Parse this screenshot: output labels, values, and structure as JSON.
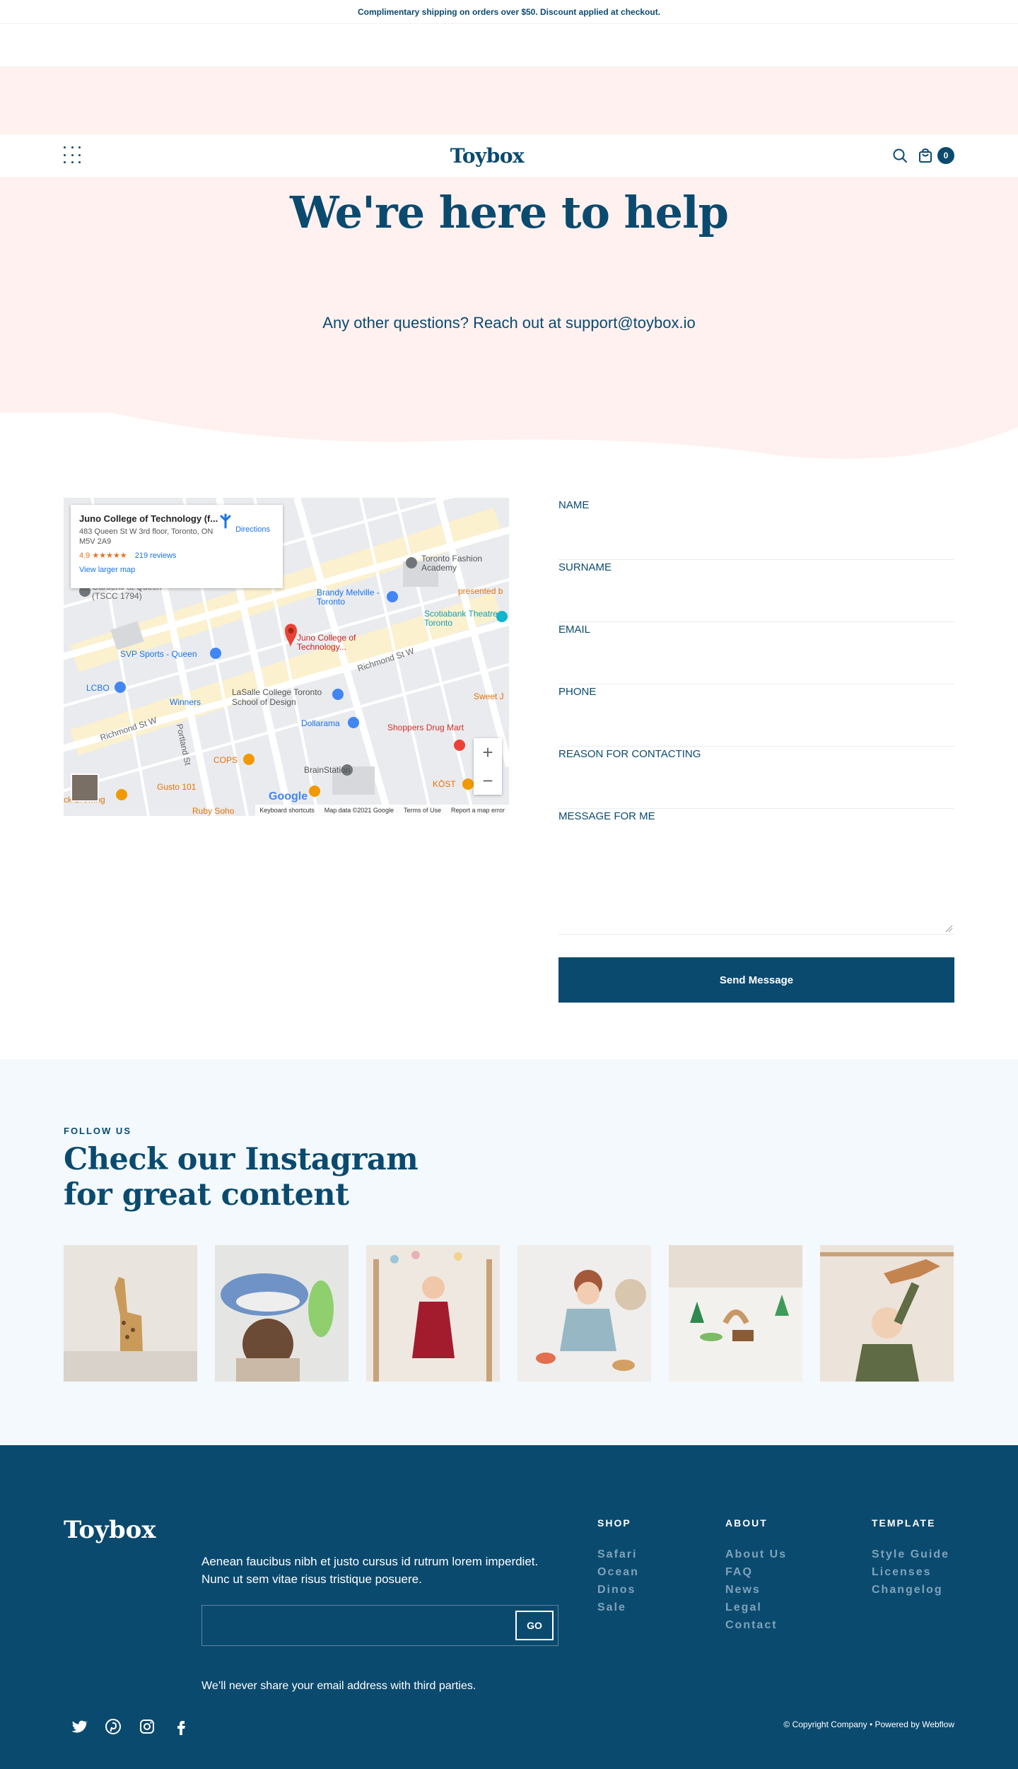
{
  "announcement": "Complimentary shipping on orders over $50. Discount applied at checkout.",
  "nav": {
    "logo": "Toybox",
    "cart_count": "0"
  },
  "hero": {
    "title": "We're here to help",
    "subtitle": "Any other questions? Reach out at support@toybox.io"
  },
  "map": {
    "place_name": "Juno College of Technology (f...",
    "address": "483 Queen St W 3rd floor, Toronto, ON M5V 2A9",
    "rating": "4.9 ★★★★★",
    "reviews": "219 reviews",
    "larger_map": "View larger map",
    "directions": "Directions",
    "labels": {
      "gardens": "Gardens at Queen (TSCC 1794)",
      "brandy": "Brandy Melville - Toronto",
      "fashion": "Toronto Fashion Academy",
      "scotiabank": "Scotiabank Theatre Toronto",
      "presented": "presented b",
      "juno": "Juno College of Technology...",
      "svp": "SVP Sports - Queen",
      "lcbo": "LCBO",
      "winners": "Winners",
      "lasalle": "LaSalle College Toronto School of Design",
      "dollarama": "Dollarama",
      "shoppers": "Shoppers Drug Mart",
      "sweet": "Sweet J",
      "cops": "COPS",
      "gusto": "Gusto 101",
      "brainstation": "BrainStation",
      "kost": "KŌST",
      "brewing": "ck Brewing",
      "ruby": "Ruby Soho",
      "richmond_w": "Richmond St W",
      "richmond_e": "Richmond St W",
      "portland": "Portland St"
    },
    "footer": {
      "shortcuts": "Keyboard shortcuts",
      "mapdata": "Map data ©2021 Google",
      "terms": "Terms of Use",
      "report": "Report a map error"
    },
    "google": "Google"
  },
  "form": {
    "name_label": "NAME",
    "surname_label": "SURNAME",
    "email_label": "EMAIL",
    "phone_label": "PHONE",
    "reason_label": "REASON FOR CONTACTING",
    "message_label": "MESSAGE FOR ME",
    "submit": "Send Message"
  },
  "instagram": {
    "eyebrow": "FOLLOW US",
    "title": "Check our Instagram for great content",
    "images": [
      {
        "name": "wooden-giraffe"
      },
      {
        "name": "child-with-whale-toy"
      },
      {
        "name": "girl-in-red-dress"
      },
      {
        "name": "child-playing-floor"
      },
      {
        "name": "wooden-toy-animals"
      },
      {
        "name": "child-with-dinosaur"
      }
    ]
  },
  "footer": {
    "logo": "Toybox",
    "description": "Aenean faucibus nibh et justo cursus id rutrum lorem imperdiet. Nunc ut sem vitae risus tristique posuere.",
    "go": "GO",
    "note": "We’ll never share your email address with third parties.",
    "shop": {
      "heading": "SHOP",
      "links": [
        "Safari",
        "Ocean",
        "Dinos",
        "Sale"
      ]
    },
    "about": {
      "heading": "ABOUT",
      "links": [
        "About Us",
        "FAQ",
        "News",
        "Legal",
        "Contact"
      ]
    },
    "template": {
      "heading": "TEMPLATE",
      "links": [
        "Style Guide",
        "Licenses",
        "Changelog"
      ]
    },
    "copyright": "© Copyright Company • Powered by Webflow",
    "socials": [
      "twitter-icon",
      "pinterest-icon",
      "instagram-icon",
      "facebook-icon"
    ]
  },
  "colors": {
    "primary": "#0b4a6f",
    "hero_bg": "#fff1ef",
    "insta_bg": "#f3f9fc"
  }
}
